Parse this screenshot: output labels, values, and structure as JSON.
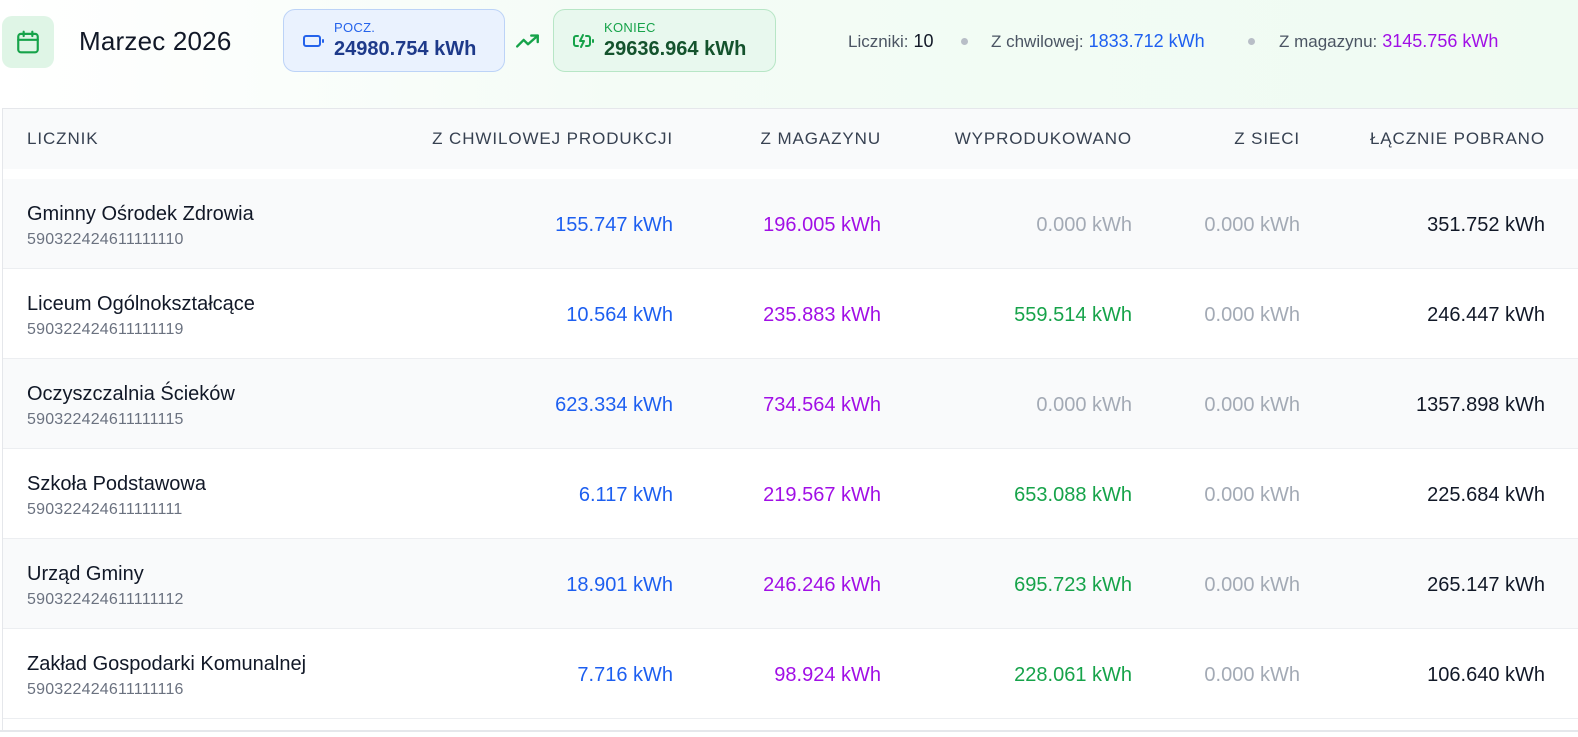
{
  "header": {
    "title": "Marzec 2026",
    "start": {
      "label": "POCZ.",
      "value": "24980.754 kWh"
    },
    "end": {
      "label": "KONIEC",
      "value": "29636.964 kWh"
    },
    "summary": {
      "meters_label": "Liczniki:",
      "meters_value": "10",
      "instant_label": "Z chwilowej:",
      "instant_value": "1833.712 kWh",
      "storage_label": "Z magazynu:",
      "storage_value": "3145.756 kWh"
    }
  },
  "table": {
    "columns": [
      "LICZNIK",
      "Z CHWILOWEJ PRODUKCJI",
      "Z MAGAZYNU",
      "WYPRODUKOWANO",
      "Z SIECI",
      "ŁĄCZNIE POBRANO"
    ],
    "rows": [
      {
        "name": "Gminny Ośrodek Zdrowia",
        "id": "590322424611111110",
        "instant": "155.747 kWh",
        "storage": "196.005 kWh",
        "produced": "0.000 kWh",
        "grid": "0.000 kWh",
        "total": "351.752 kWh",
        "produced_positive": false
      },
      {
        "name": "Liceum Ogólnokształcące",
        "id": "590322424611111119",
        "instant": "10.564 kWh",
        "storage": "235.883 kWh",
        "produced": "559.514 kWh",
        "grid": "0.000 kWh",
        "total": "246.447 kWh",
        "produced_positive": true
      },
      {
        "name": "Oczyszczalnia Ścieków",
        "id": "590322424611111115",
        "instant": "623.334 kWh",
        "storage": "734.564 kWh",
        "produced": "0.000 kWh",
        "grid": "0.000 kWh",
        "total": "1357.898 kWh",
        "produced_positive": false
      },
      {
        "name": "Szkoła Podstawowa",
        "id": "590322424611111111",
        "instant": "6.117 kWh",
        "storage": "219.567 kWh",
        "produced": "653.088 kWh",
        "grid": "0.000 kWh",
        "total": "225.684 kWh",
        "produced_positive": true
      },
      {
        "name": "Urząd Gminy",
        "id": "590322424611111112",
        "instant": "18.901 kWh",
        "storage": "246.246 kWh",
        "produced": "695.723 kWh",
        "grid": "0.000 kWh",
        "total": "265.147 kWh",
        "produced_positive": true
      },
      {
        "name": "Zakład Gospodarki Komunalnej",
        "id": "590322424611111116",
        "instant": "7.716 kWh",
        "storage": "98.924 kWh",
        "produced": "228.061 kWh",
        "grid": "0.000 kWh",
        "total": "106.640 kWh",
        "produced_positive": true
      }
    ]
  },
  "colors": {
    "instant": "#1d5ff0",
    "storage": "#a10fe6",
    "produced": "#16a34a",
    "muted": "#a3aab5",
    "accent_green": "#16a34a",
    "accent_blue": "#2563eb"
  },
  "icons": {
    "calendar": "calendar-icon",
    "start": "battery-icon",
    "trend": "trending-up-icon",
    "end": "battery-charging-icon"
  }
}
